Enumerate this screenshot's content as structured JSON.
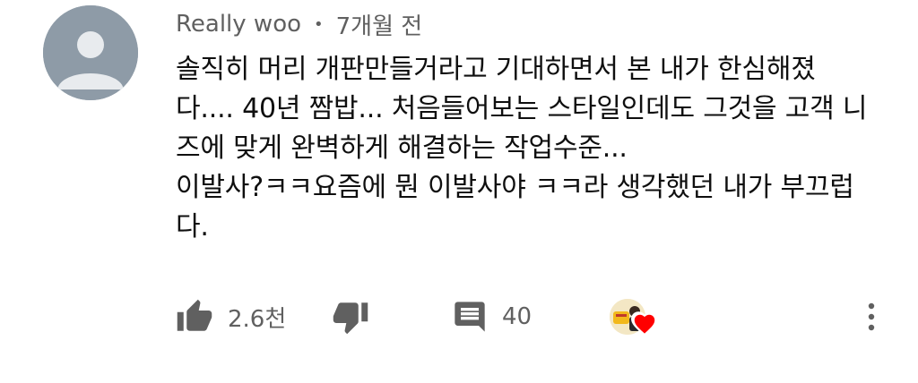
{
  "comment": {
    "author": "Really woo",
    "separator": "•",
    "time": "7개월 전",
    "lines": [
      "솔직히 머리 개판만들거라고 기대하면서 본 내가 한심해졌",
      "다.... 40년 짬밥... 처음들어보는 스타일인데도 그것을 고객 니",
      "즈에 맞게 완벽하게 해결하는 작업수준...",
      "이발사?ㅋㅋ요즘에 뭔 이발사야 ㅋㅋ라 생각했던 내가 부끄럽",
      "다."
    ]
  },
  "actions": {
    "like_count": "2.6천",
    "reply_count": "40"
  },
  "icons": {
    "like": "thumb-up-icon",
    "dislike": "thumb-down-icon",
    "reply": "comment-icon",
    "heart": "creator-heart-icon",
    "more": "more-vert-icon"
  },
  "colors": {
    "avatar_bg": "#8e9ba7",
    "text": "#0f0f0f",
    "meta": "#606060",
    "heart": "#ff0000"
  }
}
